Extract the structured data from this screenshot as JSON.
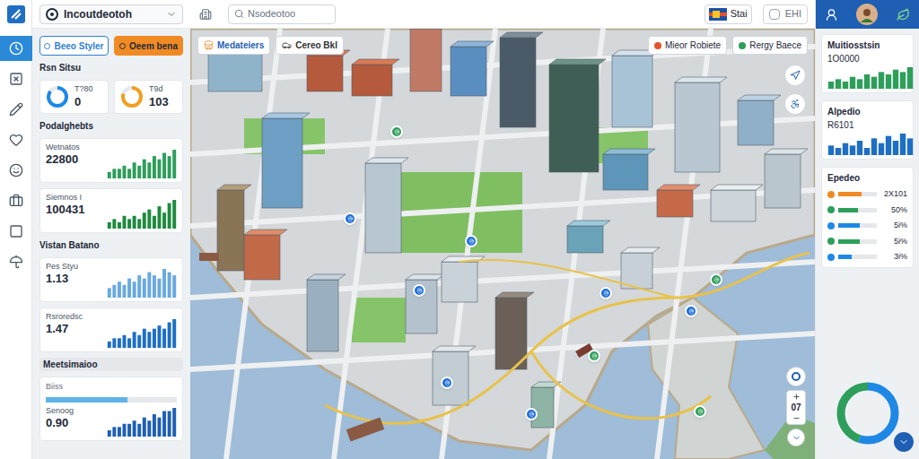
{
  "topbar": {
    "project": "Incoutdeotoh",
    "search": "Nsodeotoo",
    "flag_label": "Stai",
    "badge": "EHI"
  },
  "rail": [
    {
      "selected": true
    },
    {
      "selected": false
    },
    {
      "selected": false
    },
    {
      "selected": false
    },
    {
      "selected": false
    },
    {
      "selected": false
    },
    {
      "selected": false
    },
    {
      "selected": false
    }
  ],
  "left": {
    "buttons": [
      {
        "label": "Beeo Styler",
        "color": "#2f7fd6"
      },
      {
        "label": "Oeem bena",
        "color": "#f08a24"
      }
    ],
    "status_title": "Rsn Sitsu",
    "rings": [
      {
        "label": "T?80",
        "value": "0",
        "level": 0.85,
        "color": "#1e88e5"
      },
      {
        "label": "T9d",
        "value": "103",
        "level": 0.8,
        "color": "#f0a020"
      }
    ],
    "sections": [
      {
        "title": "Podalghebts",
        "cards": [
          {
            "label": "Wetnatos",
            "value": "22800",
            "color": "#2e9e5b",
            "series": [
              2,
              3,
              3,
              4,
              3,
              5,
              4,
              6,
              5,
              7,
              6,
              8,
              7,
              9
            ]
          },
          {
            "label": "Siemnos I",
            "value": "100431",
            "color": "#1f8a3f",
            "series": [
              2,
              3,
              2,
              4,
              3,
              4,
              3,
              5,
              6,
              4,
              7,
              5,
              8,
              9
            ]
          }
        ]
      },
      {
        "title": "Vistan Batano",
        "cards": [
          {
            "label": "Pes Styu",
            "value": "1.13",
            "color": "#6aa9e0",
            "series": [
              3,
              4,
              5,
              4,
              6,
              5,
              7,
              6,
              8,
              7,
              6,
              9,
              8,
              7
            ]
          },
          {
            "label": "Rsroredsc",
            "value": "1.47",
            "color": "#1e6fc4",
            "series": [
              2,
              3,
              3,
              4,
              3,
              5,
              4,
              6,
              5,
              6,
              7,
              6,
              8,
              9
            ]
          }
        ]
      }
    ],
    "meter": {
      "title": "Meetsimaioo",
      "meter_label": "Biiss",
      "level": 0.62,
      "label": "Senoog",
      "value": "0.90",
      "color": "#1e5fb4",
      "series": [
        2,
        3,
        3,
        4,
        4,
        5,
        4,
        6,
        5,
        7,
        6,
        8,
        8,
        9
      ]
    }
  },
  "map": {
    "labels_left": [
      {
        "label": "Medateiers",
        "color": "#f08a24"
      },
      {
        "label": "Cereo Bkl",
        "color": "#333333"
      }
    ],
    "labels_right": [
      {
        "label": "Mieor Robiete",
        "color": "#e5532d"
      },
      {
        "label": "Rergy Baece",
        "color": "#2e9e5b"
      }
    ],
    "pins": [
      {
        "color": "#2e9e5b"
      },
      {
        "color": "#1e6fd9"
      },
      {
        "color": "#1e6fd9"
      },
      {
        "color": "#1e6fd9"
      },
      {
        "color": "#1e6fd9"
      },
      {
        "color": "#1e6fd9"
      },
      {
        "color": "#1e6fd9"
      },
      {
        "color": "#2e9e5b"
      },
      {
        "color": "#1e6fd9"
      },
      {
        "color": "#2e9e5b"
      },
      {
        "color": "#2e9e5b"
      }
    ],
    "zoom": "07"
  },
  "right": {
    "cards": [
      {
        "title": "Muitiosstsin",
        "value": "1O0000",
        "color": "#2e9e5b",
        "series": [
          3,
          4,
          3,
          5,
          4,
          6,
          5,
          7,
          6,
          8,
          7,
          9
        ]
      },
      {
        "title": "Alpedio",
        "value": "R6101",
        "color": "#1e6fc4",
        "series": [
          4,
          3,
          5,
          4,
          6,
          3,
          7,
          5,
          8,
          6,
          9,
          7
        ]
      }
    ],
    "list_title": "Epedeo",
    "rows": [
      {
        "reading": "2X101",
        "level": 0.6,
        "color": "#f08a24"
      },
      {
        "reading": "50%",
        "level": 0.5,
        "color": "#2e9e5b"
      },
      {
        "reading": "5i%",
        "level": 0.55,
        "color": "#1e88e5"
      },
      {
        "reading": "5i%",
        "level": 0.55,
        "color": "#2e9e5b"
      },
      {
        "reading": "3i%",
        "level": 0.35,
        "color": "#1e88e5"
      }
    ],
    "donut": [
      {
        "value": 0.55,
        "color": "#1e88e5"
      },
      {
        "value": 0.45,
        "color": "#2e9e5b"
      }
    ]
  }
}
